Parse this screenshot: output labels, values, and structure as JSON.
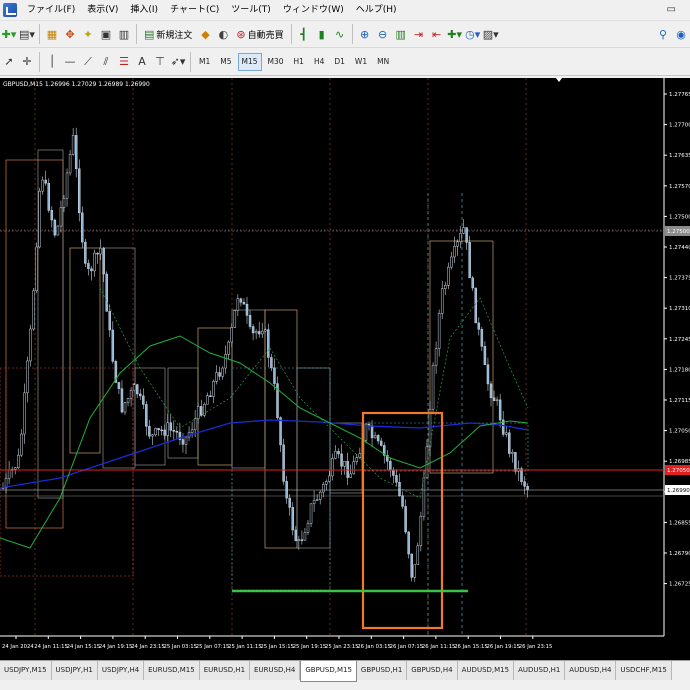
{
  "menu": {
    "items": [
      "ファイル(F)",
      "表示(V)",
      "挿入(I)",
      "チャート(C)",
      "ツール(T)",
      "ウィンドウ(W)",
      "ヘルプ(H)"
    ]
  },
  "toolbar": {
    "new_order_label": "新規注文",
    "auto_trading_label": "自動売買",
    "timeframes": [
      "M1",
      "M5",
      "M15",
      "M30",
      "H1",
      "H4",
      "D1",
      "W1",
      "MN"
    ],
    "active_timeframe": "M15"
  },
  "chart": {
    "title": "GBPUSD,M15  1.26996 1.27029 1.26989 1.26990",
    "y_labels": [
      "1.27765",
      "1.27700",
      "1.27635",
      "1.27570",
      "1.27500",
      "1.27440",
      "1.27375",
      "1.27310",
      "1.27245",
      "1.27180",
      "1.27115",
      "1.27050",
      "1.26985",
      "1.26920",
      "1.26855",
      "1.26790",
      "1.26725"
    ],
    "highlight_labels": {
      "gray": "1.27500",
      "red": "1.27050",
      "current": "1.26990"
    },
    "x_labels": [
      "24 Jan 2024",
      "24 Jan 11:15",
      "24 Jan 15:15",
      "24 Jan 19:15",
      "24 Jan 23:15",
      "25 Jan 03:15",
      "25 Jan 07:15",
      "25 Jan 11:15",
      "25 Jan 15:15",
      "25 Jan 19:15",
      "25 Jan 23:15",
      "26 Jan 03:15",
      "26 Jan 07:15",
      "26 Jan 11:15",
      "26 Jan 15:15",
      "26 Jan 19:15",
      "26 Jan 23:15"
    ],
    "colors": {
      "background": "#000000",
      "candle": "#c8d4e0",
      "candle_bull": "#8fb8d8",
      "ma_blue": "#1a2cd6",
      "ma_green": "#22b03a",
      "red_line": "#e02020",
      "orange_box": "#f07a2a",
      "green_line": "#3cc04a"
    }
  },
  "tabs": [
    "USDJPY,M15",
    "USDJPY,H1",
    "USDJPY,H4",
    "EURUSD,M15",
    "EURUSD,H1",
    "EURUSD,H4",
    "GBPUSD,M15",
    "GBPUSD,H1",
    "GBPUSD,H4",
    "AUDUSD,M15",
    "AUDUSD,H1",
    "AUDUSD,H4",
    "USDCHF,M15"
  ],
  "active_tab": "GBPUSD,M15"
}
